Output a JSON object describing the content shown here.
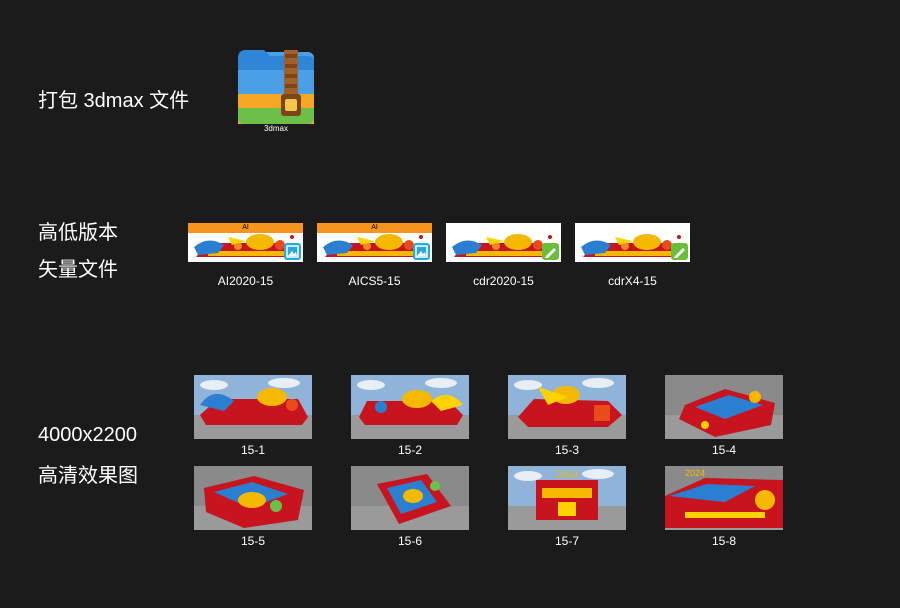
{
  "section_3dmax": {
    "label": "打包 3dmax 文件",
    "file_icon_name": "zip-archive-icon",
    "file_icon_caption": "3dmax"
  },
  "section_vector": {
    "label_line1": "高低版本",
    "label_line2": "矢量文件",
    "files": [
      {
        "caption": "AI2020-15",
        "banner_text": "AI",
        "banner_color": "#f7941d",
        "badge_icon": "image-icon",
        "badge_color": "#26a9e0"
      },
      {
        "caption": "AICS5-15",
        "banner_text": "AI",
        "banner_color": "#f7941d",
        "badge_icon": "image-icon",
        "badge_color": "#26a9e0"
      },
      {
        "caption": "cdr2020-15",
        "banner_text": "",
        "banner_color": "#ffffff",
        "badge_icon": "pen-icon",
        "badge_color": "#6abf3a"
      },
      {
        "caption": "cdrX4-15",
        "banner_text": "",
        "banner_color": "#ffffff",
        "badge_icon": "pen-icon",
        "badge_color": "#6abf3a"
      }
    ]
  },
  "section_renders": {
    "label_line1": "4000x2200",
    "label_line2": "高清效果图",
    "images": [
      {
        "caption": "15-1",
        "view": "side-left"
      },
      {
        "caption": "15-2",
        "view": "side-right"
      },
      {
        "caption": "15-3",
        "view": "front-angle"
      },
      {
        "caption": "15-4",
        "view": "rear-angle"
      },
      {
        "caption": "15-5",
        "view": "top-angle"
      },
      {
        "caption": "15-6",
        "view": "top-down"
      },
      {
        "caption": "15-7",
        "view": "rear"
      },
      {
        "caption": "15-8",
        "view": "close-up"
      }
    ]
  },
  "colors": {
    "background": "#1b1b1b",
    "text": "#ffffff",
    "float_red": "#c8141e",
    "float_gold": "#f5b800",
    "sky": "#8fb3d9",
    "ground": "#9a9a9a"
  }
}
